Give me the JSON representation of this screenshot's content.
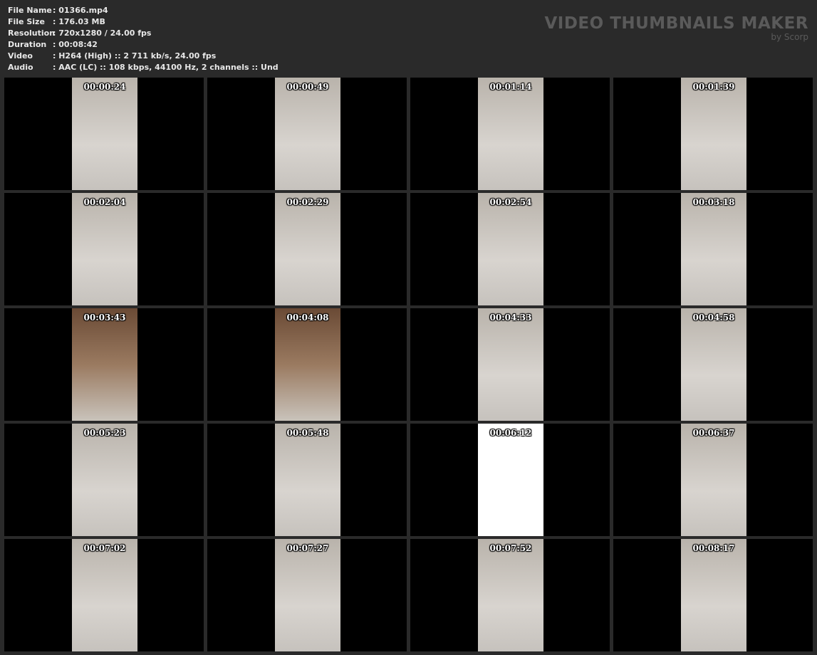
{
  "info": [
    {
      "label": "File Name",
      "value": ": 01366.mp4"
    },
    {
      "label": "File Size",
      "value": ": 176.03 MB"
    },
    {
      "label": "Resolution",
      "value": ": 720x1280 / 24.00 fps"
    },
    {
      "label": "Duration",
      "value": ": 00:08:42"
    },
    {
      "label": "Video",
      "value": ": H264 (High) :: 2 711 kb/s, 24.00 fps"
    },
    {
      "label": "Audio",
      "value": ": AAC (LC) :: 108 kbps, 44100 Hz, 2 channels :: Und"
    }
  ],
  "brand": {
    "title": "VIDEO THUMBNAILS MAKER",
    "subtitle": "by Scorp"
  },
  "thumbnails": [
    "00:00:24",
    "00:00:49",
    "00:01:14",
    "00:01:39",
    "00:02:04",
    "00:02:29",
    "00:02:54",
    "00:03:18",
    "00:03:43",
    "00:04:08",
    "00:04:33",
    "00:04:58",
    "00:05:23",
    "00:05:48",
    "00:06:12",
    "00:06:37",
    "00:07:02",
    "00:07:27",
    "00:07:52",
    "00:08:17"
  ]
}
